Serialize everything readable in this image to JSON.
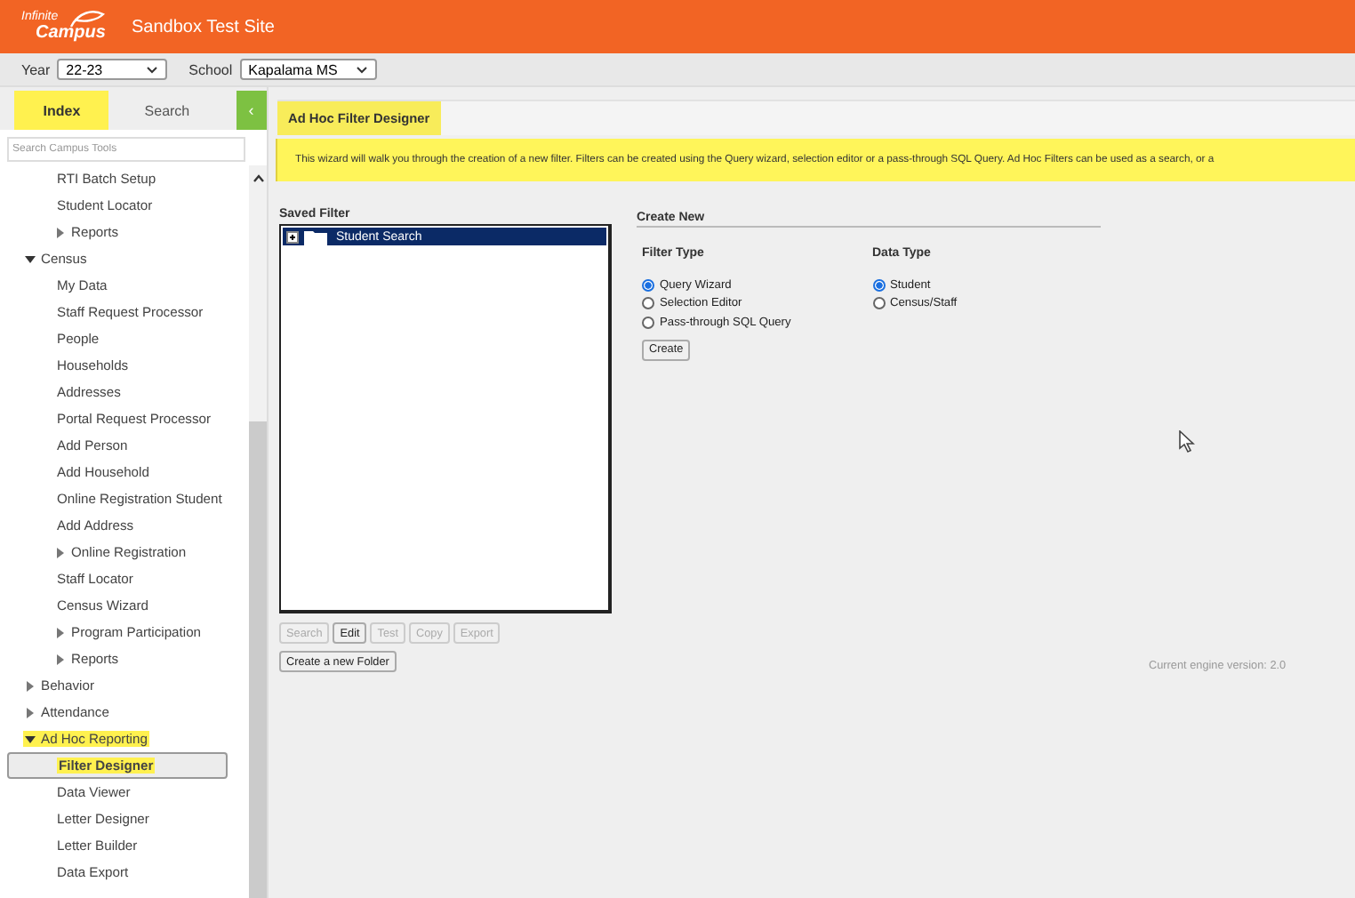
{
  "header": {
    "logo_top": "Infinite",
    "logo_bottom": "Campus",
    "site_title": "Sandbox Test Site"
  },
  "toolbar": {
    "year_label": "Year",
    "year_value": "22-23",
    "school_label": "School",
    "school_value": "Kapalama MS"
  },
  "sidebar": {
    "tabs": [
      {
        "label": "Index",
        "selected": true
      },
      {
        "label": "Search",
        "selected": false
      }
    ],
    "collapse_button": "‹",
    "search": {
      "placeholder": "Search Campus Tools"
    },
    "tree_continued": [
      {
        "label": "RTI Batch Setup",
        "selected": false,
        "highlighted": false
      },
      {
        "label": "Student Locator",
        "selected": false,
        "highlighted": false
      },
      {
        "label": "Reports",
        "expanded": false,
        "selected": false,
        "highlighted": false,
        "kind": "folder"
      }
    ],
    "tree": [
      {
        "label": "Census",
        "kind": "folder",
        "expanded": true,
        "selected": false,
        "highlighted": false,
        "children": [
          {
            "label": "My Data",
            "selected": false,
            "highlighted": false
          },
          {
            "label": "Staff Request Processor",
            "selected": false,
            "highlighted": false
          },
          {
            "label": "People",
            "selected": false,
            "highlighted": false
          },
          {
            "label": "Households",
            "selected": false,
            "highlighted": false
          },
          {
            "label": "Addresses",
            "selected": false,
            "highlighted": false
          },
          {
            "label": "Portal Request Processor",
            "selected": false,
            "highlighted": false
          },
          {
            "label": "Add Person",
            "selected": false,
            "highlighted": false
          },
          {
            "label": "Add Household",
            "selected": false,
            "highlighted": false
          },
          {
            "label": "Online Registration Student",
            "selected": false,
            "highlighted": false
          },
          {
            "label": "Add Address",
            "selected": false,
            "highlighted": false
          },
          {
            "label": "Online Registration",
            "expanded": false,
            "selected": false,
            "highlighted": false,
            "kind": "folder"
          },
          {
            "label": "Staff Locator",
            "selected": false,
            "highlighted": false
          },
          {
            "label": "Census Wizard",
            "selected": false,
            "highlighted": false
          },
          {
            "label": "Program Participation",
            "expanded": false,
            "selected": false,
            "highlighted": false,
            "kind": "folder"
          },
          {
            "label": "Reports",
            "expanded": false,
            "selected": false,
            "highlighted": false,
            "kind": "folder"
          }
        ]
      },
      {
        "label": "Behavior",
        "expanded": false,
        "selected": false,
        "highlighted": false,
        "kind": "folder"
      },
      {
        "label": "Attendance",
        "expanded": false,
        "selected": false,
        "highlighted": false,
        "kind": "folder"
      },
      {
        "label": "Ad Hoc Reporting",
        "kind": "folder",
        "expanded": true,
        "selected": false,
        "highlighted": true,
        "children": [
          {
            "label": "Filter Designer",
            "selected": true,
            "highlighted": true
          },
          {
            "label": "Data Viewer",
            "selected": false,
            "highlighted": false
          },
          {
            "label": "Letter Designer",
            "selected": false,
            "highlighted": false
          },
          {
            "label": "Letter Builder",
            "selected": false,
            "highlighted": false
          },
          {
            "label": "Data Export",
            "selected": false,
            "highlighted": false
          }
        ]
      }
    ]
  },
  "page_tab": {
    "label": "Ad Hoc Filter Designer",
    "selected": true
  },
  "banner": "This wizard will walk you through the creation of a new filter. Filters can be created using the Query wizard, selection editor or a pass-through SQL Query. Ad Hoc Filters can be used as a search, or a",
  "saved_filter": {
    "title": "Saved Filter",
    "items": [
      {
        "label": "Student Search",
        "selected": true
      }
    ],
    "buttons": [
      {
        "label": "Search",
        "disabled": true
      },
      {
        "label": "Edit",
        "disabled": false
      },
      {
        "label": "Test",
        "disabled": true
      },
      {
        "label": "Copy",
        "disabled": true
      },
      {
        "label": "Export",
        "disabled": true
      }
    ],
    "folder_button": "Create a new Folder"
  },
  "create_new": {
    "title": "Create New",
    "filter_type": {
      "title": "Filter Type",
      "options": [
        {
          "label": "Query Wizard",
          "selected": true
        },
        {
          "label": "Selection Editor",
          "selected": false
        },
        {
          "label": "Pass-through SQL Query",
          "selected": false
        }
      ]
    },
    "create_button": "Create",
    "data_type": {
      "title": "Data Type",
      "options": [
        {
          "label": "Student",
          "selected": true
        },
        {
          "label": "Census/Staff",
          "selected": false
        }
      ]
    }
  },
  "engine_version": "Current engine version: 2.0"
}
